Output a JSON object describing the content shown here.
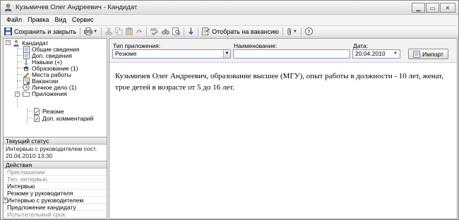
{
  "window": {
    "title": "Кузьмичев Олег Андреевич - Кандидат"
  },
  "menu": [
    "Файл",
    "Правка",
    "Вид",
    "Сервис"
  ],
  "toolbar": {
    "save_close_label": "Сохранить и закрыть",
    "assign_label": "Отобрать на вакансию"
  },
  "tree": {
    "root": "Кандидат",
    "items": [
      "Общие сведения",
      "Доп. сведения",
      "Навыки (+)",
      "Образование (1)",
      "Места работы",
      "Вакансии",
      "Личное дело (1)"
    ],
    "attachments_folder": "Приложения",
    "attachments": [
      "Резюме",
      "Доп. комментарий"
    ]
  },
  "status": {
    "header": "Текущий статус",
    "text": "Интервью с руководителем сост. 20.04.2010 13:30"
  },
  "actions": {
    "header": "Действия",
    "items": [
      {
        "label": "Приглашение",
        "enabled": false
      },
      {
        "label": "Тел. интервью",
        "enabled": false
      },
      {
        "label": "Интервью",
        "enabled": true
      },
      {
        "label": "Резюме у руководителя",
        "enabled": true
      },
      {
        "label": "Интервью с руководителем",
        "enabled": true,
        "marked": true
      },
      {
        "label": "Предложение кандидату",
        "enabled": true
      },
      {
        "label": "Испытательный срок",
        "enabled": false
      }
    ]
  },
  "form": {
    "type_label": "Тип приложения:",
    "type_value": "Резюме",
    "name_label": "Наименование:",
    "name_value": "",
    "date_label": "Дата:",
    "date_value": "20.04.2010",
    "import_label": "Импорт"
  },
  "content": {
    "text": "Кузьмичев Олег Андреевич, образование высшее (МГУ), опыт работы в должности - 10 лет, женат, трое детей в возрасте от 5 до 16 лет."
  }
}
